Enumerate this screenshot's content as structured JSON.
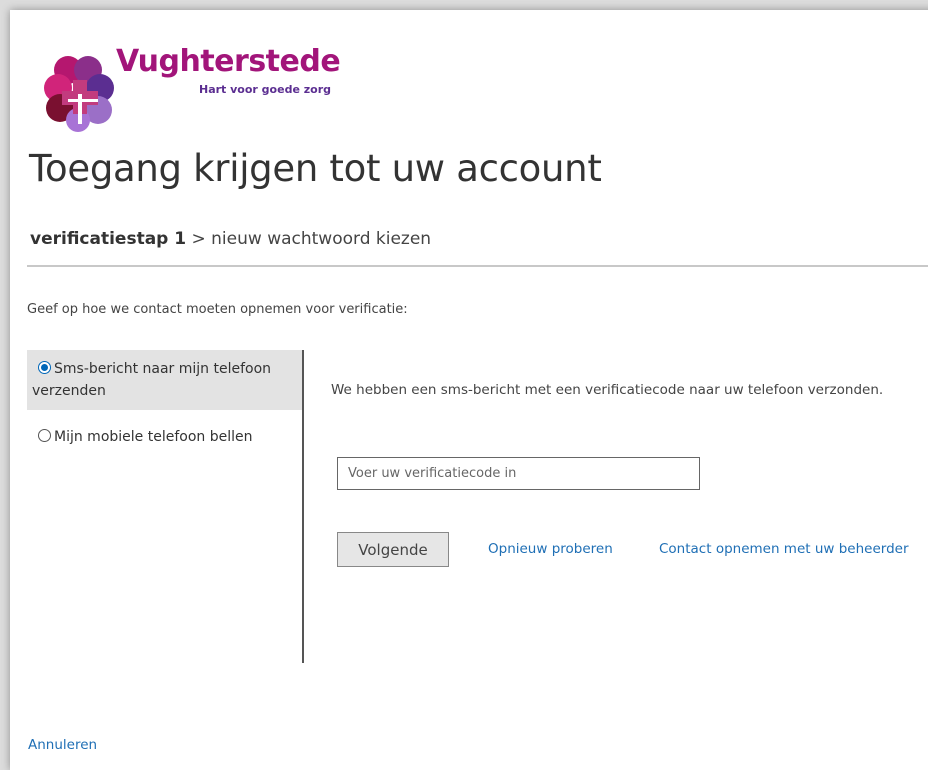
{
  "brand": {
    "name": "Vughterstede",
    "tagline": "Hart voor goede zorg",
    "colors": {
      "magenta": "#b5176f",
      "purple": "#5b2e91",
      "lilac": "#9b6fc7",
      "dark_red": "#7a1030"
    }
  },
  "page": {
    "title": "Toegang krijgen tot uw account",
    "breadcrumb": {
      "current_step": "verificatiestap 1",
      "separator": ">",
      "next_step": "nieuw wachtwoord kiezen"
    },
    "instruction": "Geef op hoe we contact moeten opnemen voor verificatie:"
  },
  "options": [
    {
      "label": "Sms-bericht naar mijn telefoon verzenden",
      "selected": true
    },
    {
      "label": "Mijn mobiele telefoon bellen",
      "selected": false
    }
  ],
  "verification": {
    "message": "We hebben een sms-bericht met een verificatiecode naar uw telefoon verzonden.",
    "input_placeholder": "Voer uw verificatiecode in",
    "input_value": "",
    "next_button": "Volgende",
    "retry_link": "Opnieuw proberen",
    "contact_link": "Contact opnemen met uw beheerder"
  },
  "footer": {
    "cancel_link": "Annuleren"
  }
}
